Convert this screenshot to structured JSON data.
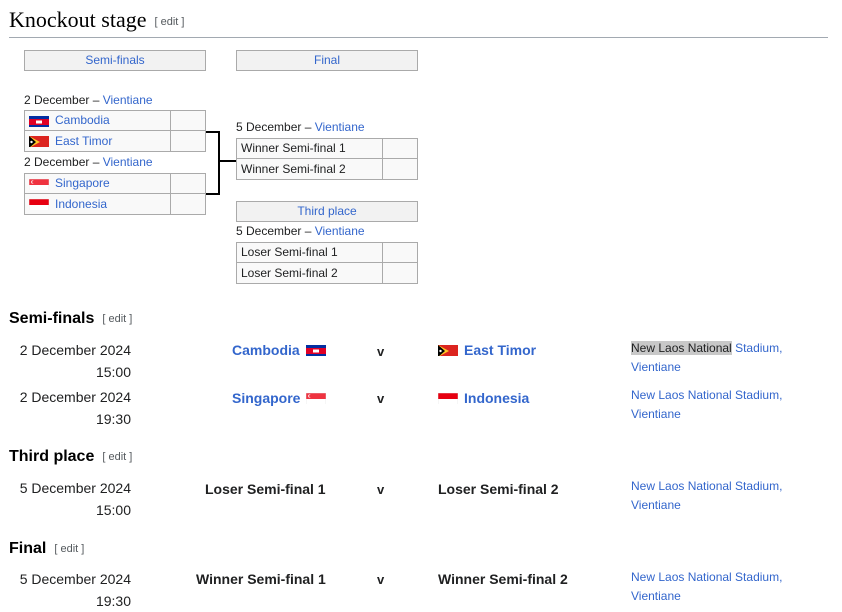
{
  "heading": {
    "title": "Knockout stage",
    "edit": "[ edit ]"
  },
  "bracket": {
    "semis_header": "Semi-finals",
    "final_header": "Final",
    "third_header": "Third place",
    "semi1": {
      "date": "2 December",
      "sep": " – ",
      "venue": "Vientiane",
      "teams": [
        {
          "name": "Cambodia",
          "flag": "cambodia-flag-icon"
        },
        {
          "name": "East Timor",
          "flag": "east-timor-flag-icon"
        }
      ]
    },
    "semi2": {
      "date": "2 December",
      "sep": " – ",
      "venue": "Vientiane",
      "teams": [
        {
          "name": "Singapore",
          "flag": "singapore-flag-icon"
        },
        {
          "name": "Indonesia",
          "flag": "indonesia-flag-icon"
        }
      ]
    },
    "final": {
      "date": "5 December",
      "sep": " – ",
      "venue": "Vientiane",
      "teams": [
        {
          "name": "Winner Semi-final 1"
        },
        {
          "name": "Winner Semi-final 2"
        }
      ]
    },
    "third": {
      "date": "5 December",
      "sep": " – ",
      "venue": "Vientiane",
      "teams": [
        {
          "name": "Loser Semi-final 1"
        },
        {
          "name": "Loser Semi-final 2"
        }
      ]
    }
  },
  "sections": {
    "semis": {
      "title": "Semi-finals",
      "edit": "[ edit ]"
    },
    "third": {
      "title": "Third place",
      "edit": "[ edit ]"
    },
    "final": {
      "title": "Final",
      "edit": "[ edit ]"
    }
  },
  "matches": [
    {
      "date": "2 December 2024",
      "time": "15:00",
      "home": "Cambodia",
      "vs": "v",
      "away": "East Timor",
      "venue_hl": "New Laos National",
      "venue_rest": " Stadium,",
      "city": "Vientiane"
    },
    {
      "date": "2 December 2024",
      "time": "19:30",
      "home": "Singapore",
      "vs": "v",
      "away": "Indonesia",
      "venue": "New Laos National Stadium,",
      "city": "Vientiane"
    },
    {
      "date": "5 December 2024",
      "time": "15:00",
      "home": "Loser Semi-final 1",
      "vs": "v",
      "away": "Loser Semi-final 2",
      "venue": "New Laos National Stadium,",
      "city": "Vientiane"
    },
    {
      "date": "5 December 2024",
      "time": "19:30",
      "home": "Winner Semi-final 1",
      "vs": "v",
      "away": "Winner Semi-final 2",
      "venue": "New Laos National Stadium,",
      "city": "Vientiane"
    }
  ],
  "colors": {
    "link": "#3366cc",
    "cell_border": "#aaaaaa",
    "header_bg": "#f2f2f2",
    "highlight": "#c8c8c8"
  }
}
